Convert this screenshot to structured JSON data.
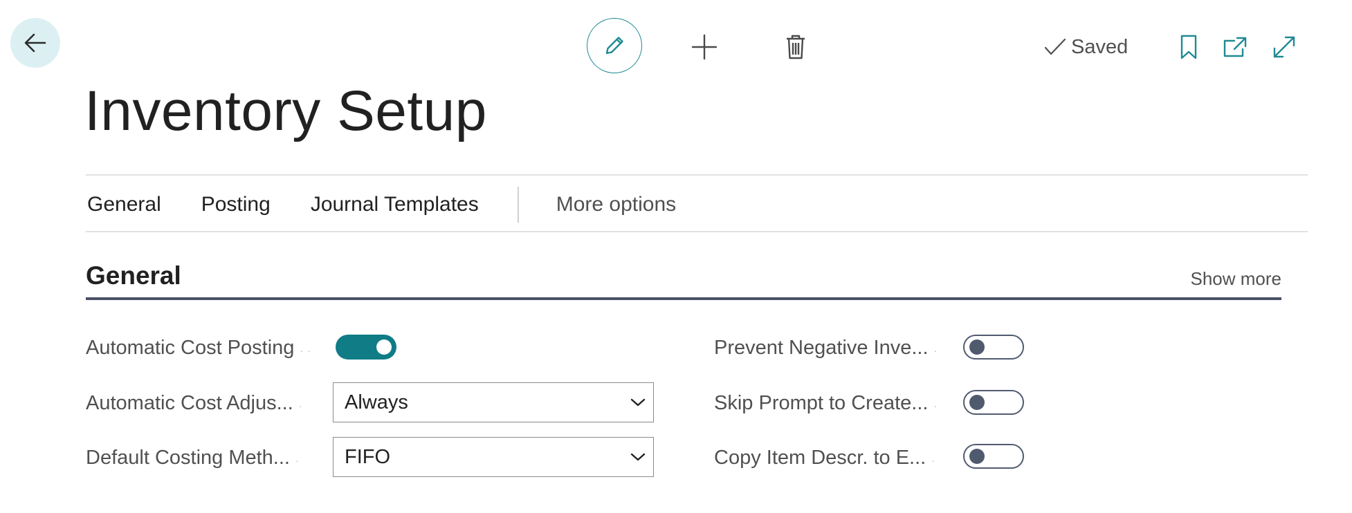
{
  "toolbar": {
    "saved_label": "Saved",
    "icons": [
      "back-arrow-icon",
      "edit-pencil-icon",
      "plus-icon",
      "trash-icon",
      "checkmark-icon",
      "bookmark-icon",
      "open-new-window-icon",
      "expand-icon"
    ],
    "accent_color": "#1e8a93"
  },
  "page": {
    "title": "Inventory Setup"
  },
  "tabs": {
    "items": [
      "General",
      "Posting",
      "Journal Templates"
    ],
    "more": "More options"
  },
  "section": {
    "title": "General",
    "show_more": "Show more"
  },
  "fields": {
    "automatic_cost_posting": {
      "label": "Automatic Cost Posting",
      "value": true
    },
    "automatic_cost_adjustment": {
      "label": "Automatic Cost Adjus...",
      "value": "Always"
    },
    "default_costing_method": {
      "label": "Default Costing Meth...",
      "value": "FIFO"
    },
    "prevent_negative_inventory": {
      "label": "Prevent Negative Inve...",
      "value": false
    },
    "skip_prompt_to_create": {
      "label": "Skip Prompt to Create...",
      "value": false
    },
    "copy_item_descr": {
      "label": "Copy Item Descr. to E...",
      "value": false
    }
  }
}
